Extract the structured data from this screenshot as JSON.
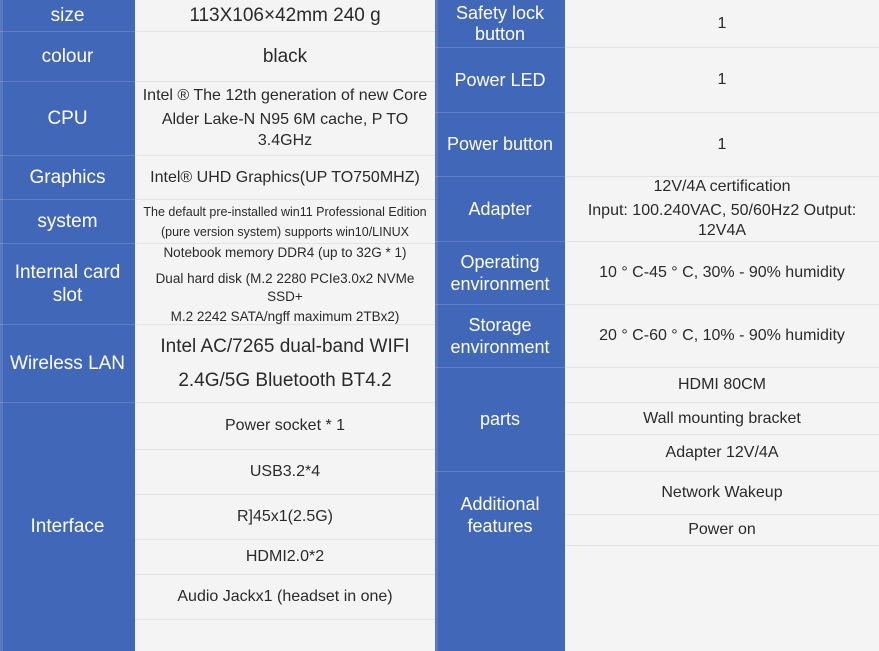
{
  "theme": {
    "label_bg": "#4067b8",
    "label_text": "#ffffff",
    "value_bg": "#f4f4f4",
    "value_text": "#2a2a2a",
    "divider": "#e3e3e3"
  },
  "left_table": {
    "rows": [
      {
        "label": "size",
        "values": [
          "113X106×42mm 240 g"
        ]
      },
      {
        "label": "colour",
        "values": [
          "black"
        ]
      },
      {
        "label": "CPU",
        "values": [
          "Intel ® The 12th generation of new Core",
          "Alder Lake-N N95 6M cache, P TO 3.4GHz"
        ]
      },
      {
        "label": "Graphics",
        "values": [
          "Intel® UHD Graphics(UP TO750MHZ)"
        ]
      },
      {
        "label": "system",
        "values": [
          "The default pre-installed win11 Professional Edition",
          "(pure version system) supports win10/LINUX"
        ]
      },
      {
        "label": "Internal card slot",
        "label_lines": [
          "Internal",
          "card slot"
        ],
        "values": [
          "Notebook memory DDR4 (up to 32G * 1)",
          "Dual hard disk (M.2 2280 PCIe3.0x2 NVMe SSD+",
          "M.2 2242 SATA/ngff maximum 2TBx2)"
        ]
      },
      {
        "label": "Wireless LAN",
        "values": [
          "Intel AC/7265 dual-band WIFI",
          "2.4G/5G Bluetooth BT4.2"
        ]
      },
      {
        "label": "Interface",
        "values": [
          "Power socket * 1",
          "USB3.2*4",
          "R]45x1(2.5G)",
          "HDMI2.0*2",
          "Audio Jackx1 (headset in one)",
          ""
        ]
      }
    ]
  },
  "right_table": {
    "rows": [
      {
        "label": "Safety lock button",
        "label_lines": [
          "Safety lock",
          "button"
        ],
        "values": [
          "1"
        ]
      },
      {
        "label": "Power LED",
        "values": [
          "1"
        ]
      },
      {
        "label": "Power button",
        "values": [
          "1"
        ]
      },
      {
        "label": "Adapter",
        "values": [
          "12V/4A certification",
          "Input: 100.240VAC, 50/60Hz2 Output: 12V4A"
        ]
      },
      {
        "label": "Operating environment",
        "label_lines": [
          "Operating",
          "environment"
        ],
        "values": [
          "10 ° C-45 ° C, 30% - 90% humidity"
        ]
      },
      {
        "label": "Storage environment",
        "label_lines": [
          "Storage",
          "environment"
        ],
        "values": [
          "20 ° C-60 ° C, 10% - 90% humidity"
        ]
      },
      {
        "label": "parts",
        "values": [
          "HDMI  80CM",
          "Wall mounting bracket",
          "Adapter 12V/4A"
        ]
      },
      {
        "label": "Additional features",
        "label_lines": [
          "Additional",
          "features"
        ],
        "values": [
          "Network Wakeup",
          "Power on",
          ""
        ]
      }
    ]
  }
}
